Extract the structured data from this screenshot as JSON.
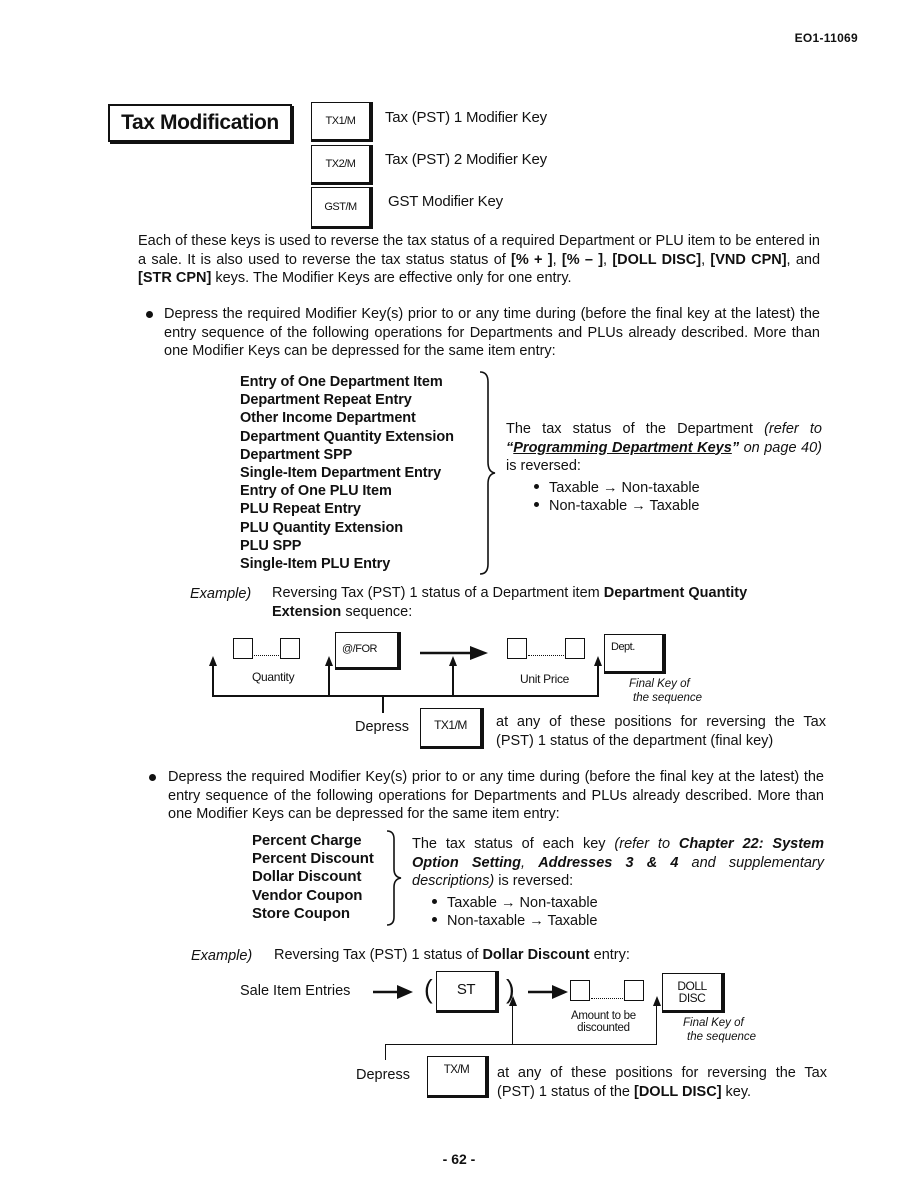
{
  "header": {
    "doc_id": "EO1-11069"
  },
  "section": {
    "title": "Tax Modification",
    "modifier_keys": [
      {
        "key": "TX1/M",
        "label": "Tax (PST) 1 Modifier Key"
      },
      {
        "key": "TX2/M",
        "label": "Tax (PST) 2 Modifier Key"
      },
      {
        "key": "GST/M",
        "label": "GST Modifier Key"
      }
    ]
  },
  "intro": {
    "t1": "Each of these keys is used to reverse the tax status of a required Department or PLU item to be entered in a sale.  It is also used to reverse the tax status status of ",
    "k1": "[% + ]",
    "s1": ", ",
    "k2": "[% – ]",
    "s2": ", ",
    "k3": "[DOLL DISC]",
    "s3": ", ",
    "k4": "[VND CPN]",
    "s4": ", and ",
    "k5": "[STR CPN]",
    "t2": " keys.  The Modifier Keys are effective only for one entry."
  },
  "bullet1": {
    "text": "Depress the required Modifier Key(s) prior to or any time during (before the final key at the latest) the entry sequence of the following operations for Departments and PLUs already described.  More than one Modifier Keys can be depressed for the same item entry:",
    "operations": [
      "Entry of One Department Item",
      "Department Repeat Entry",
      "Other Income Department",
      "Department Quantity Extension",
      "Department SPP",
      "Single-Item Department Entry",
      "Entry of One PLU Item",
      "PLU Repeat Entry",
      "PLU Quantity Extension",
      "PLU SPP",
      "Single-Item PLU Entry"
    ],
    "result": {
      "t1": "The tax status of the Department ",
      "ref_open": "(refer to ",
      "quote_open": "“",
      "link": "Programming Department Keys",
      "quote_close": "”",
      "ref_mid": " on page 40)",
      "t2": "  is reversed:"
    },
    "sub_bullets": [
      "Taxable  →  Non-taxable",
      "Non-taxable → Taxable"
    ]
  },
  "example1": {
    "label": "Example)",
    "t1": "Reversing Tax (PST) 1 status of a Department item ",
    "bold": "Department Quantity Extension",
    "t2": " sequence:",
    "diagram": {
      "quantity_caption": "Quantity",
      "for_key": "@/FOR",
      "unit_price_caption": "Unit Price",
      "dept_key": "Dept.",
      "final_key_caption_1": "Final Key of",
      "final_key_caption_2": "the sequence",
      "depress_label": "Depress",
      "modifier_key": "TX1/M",
      "depress_text": "at any of these positions for reversing the Tax (PST) 1 status of the department (final key)"
    }
  },
  "bullet2": {
    "text": "Depress the required Modifier Key(s) prior to or any time during (before the final key at the latest) the entry sequence of the following operations for Departments and PLUs already described.  More than one Modifier Keys can be depressed for the same item entry:",
    "operations": [
      "Percent Charge",
      "Percent Discount",
      "Dollar Discount",
      "Vendor Coupon",
      "Store Coupon"
    ],
    "result": {
      "t1": "The tax status of each key ",
      "i1": "(refer to ",
      "b1": "Chapter 22: System Option Setting",
      "i2": ", ",
      "b2": "Addresses 3 & 4",
      "i3": " and supplementary descriptions)",
      "t2": " is reversed:"
    },
    "sub_bullets": [
      "Taxable  →  Non-taxable",
      "Non-taxable → Taxable"
    ]
  },
  "example2": {
    "label": "Example)",
    "t1": "Reversing Tax (PST) 1 status of ",
    "bold": "Dollar Discount",
    "t2": " entry:",
    "diagram": {
      "sale_entries": "Sale Item Entries",
      "paren_open": "(",
      "st_key": "ST",
      "paren_close": ")",
      "amount_caption_1": "Amount to be",
      "amount_caption_2": "discounted",
      "doll_key_1": "DOLL",
      "doll_key_2": "DISC",
      "final_key_caption_1": "Final Key of",
      "final_key_caption_2": "the sequence",
      "depress_label": "Depress",
      "modifier_key": "TX/M",
      "depress_text_1": "at any of these positions for reversing the Tax (PST) 1 status of the ",
      "depress_bold": "[DOLL DISC]",
      "depress_text_2": " key."
    }
  },
  "footer": {
    "page_number": "- 62 -"
  }
}
